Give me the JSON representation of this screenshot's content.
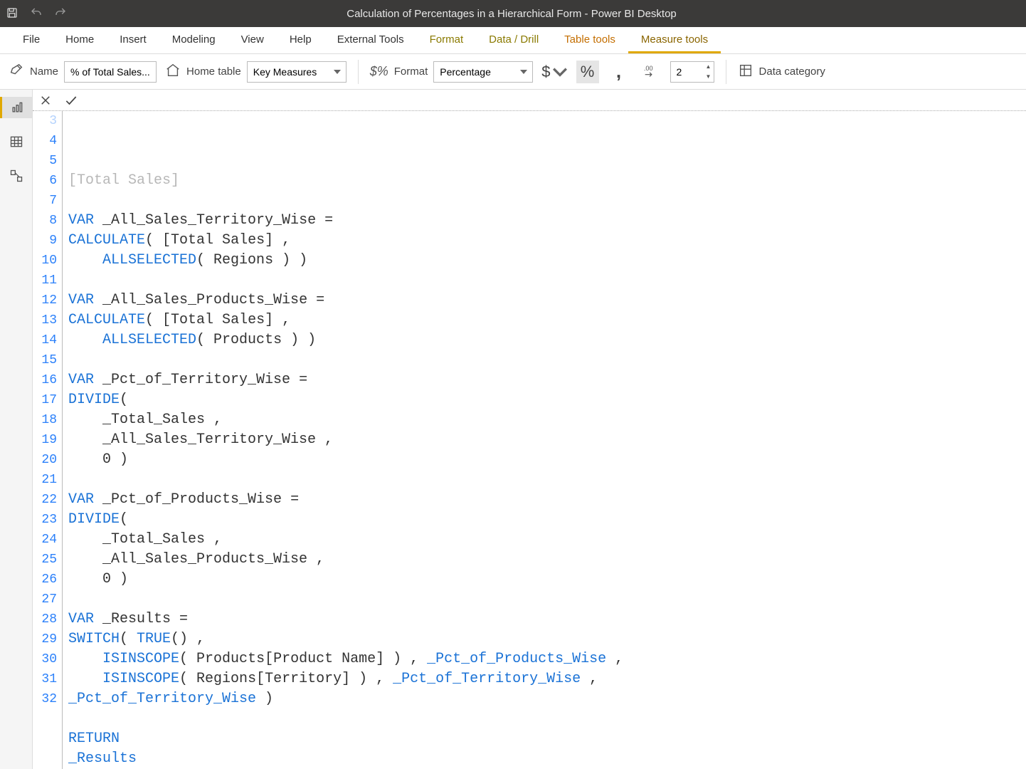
{
  "titlebar": {
    "title": "Calculation of Percentages in a Hierarchical Form - Power BI Desktop"
  },
  "ribbon_tabs": {
    "file": "File",
    "home": "Home",
    "insert": "Insert",
    "modeling": "Modeling",
    "view": "View",
    "help": "Help",
    "external_tools": "External Tools",
    "format": "Format",
    "data_drill": "Data / Drill",
    "table_tools": "Table tools",
    "measure_tools": "Measure tools"
  },
  "ribbon": {
    "name_label": "Name",
    "name_value": "% of Total Sales...",
    "home_table_label": "Home table",
    "home_table_value": "Key Measures",
    "format_label": "Format",
    "format_value": "Percentage",
    "decimals_value": "2",
    "data_category_label": "Data category"
  },
  "code_lines": [
    {
      "n": 3,
      "tokens": [
        {
          "t": "[Total Sales]",
          "c": "txt"
        }
      ],
      "faded": true
    },
    {
      "n": 4,
      "tokens": []
    },
    {
      "n": 5,
      "tokens": [
        {
          "t": "VAR",
          "c": "kw"
        },
        {
          "t": " _All_Sales_Territory_Wise ",
          "c": "txt"
        },
        {
          "t": "=",
          "c": "op"
        }
      ]
    },
    {
      "n": 6,
      "tokens": [
        {
          "t": "CALCULATE",
          "c": "fn"
        },
        {
          "t": "( ",
          "c": "op"
        },
        {
          "t": "[Total Sales]",
          "c": "txt"
        },
        {
          "t": " ,",
          "c": "op"
        }
      ]
    },
    {
      "n": 7,
      "tokens": [
        {
          "t": "    ",
          "c": "txt"
        },
        {
          "t": "ALLSELECTED",
          "c": "fn"
        },
        {
          "t": "( Regions ) )",
          "c": "txt"
        }
      ]
    },
    {
      "n": 8,
      "tokens": []
    },
    {
      "n": 9,
      "tokens": [
        {
          "t": "VAR",
          "c": "kw"
        },
        {
          "t": " _All_Sales_Products_Wise ",
          "c": "txt"
        },
        {
          "t": "=",
          "c": "op"
        }
      ]
    },
    {
      "n": 10,
      "tokens": [
        {
          "t": "CALCULATE",
          "c": "fn"
        },
        {
          "t": "( ",
          "c": "op"
        },
        {
          "t": "[Total Sales]",
          "c": "txt"
        },
        {
          "t": " ,",
          "c": "op"
        }
      ]
    },
    {
      "n": 11,
      "tokens": [
        {
          "t": "    ",
          "c": "txt"
        },
        {
          "t": "ALLSELECTED",
          "c": "fn"
        },
        {
          "t": "( Products ) )",
          "c": "txt"
        }
      ]
    },
    {
      "n": 12,
      "tokens": []
    },
    {
      "n": 13,
      "tokens": [
        {
          "t": "VAR",
          "c": "kw"
        },
        {
          "t": " _Pct_of_Territory_Wise ",
          "c": "txt"
        },
        {
          "t": "=",
          "c": "op"
        }
      ]
    },
    {
      "n": 14,
      "tokens": [
        {
          "t": "DIVIDE",
          "c": "fn"
        },
        {
          "t": "(",
          "c": "op"
        }
      ]
    },
    {
      "n": 15,
      "tokens": [
        {
          "t": "    _Total_Sales ,",
          "c": "txt"
        }
      ]
    },
    {
      "n": 16,
      "tokens": [
        {
          "t": "    _All_Sales_Territory_Wise ,",
          "c": "txt"
        }
      ]
    },
    {
      "n": 17,
      "tokens": [
        {
          "t": "    0 )",
          "c": "txt"
        }
      ]
    },
    {
      "n": 18,
      "tokens": []
    },
    {
      "n": 19,
      "tokens": [
        {
          "t": "VAR",
          "c": "kw"
        },
        {
          "t": " _Pct_of_Products_Wise ",
          "c": "txt"
        },
        {
          "t": "=",
          "c": "op"
        }
      ]
    },
    {
      "n": 20,
      "tokens": [
        {
          "t": "DIVIDE",
          "c": "fn"
        },
        {
          "t": "(",
          "c": "op"
        }
      ]
    },
    {
      "n": 21,
      "tokens": [
        {
          "t": "    _Total_Sales ,",
          "c": "txt"
        }
      ]
    },
    {
      "n": 22,
      "tokens": [
        {
          "t": "    _All_Sales_Products_Wise ,",
          "c": "txt"
        }
      ]
    },
    {
      "n": 23,
      "tokens": [
        {
          "t": "    0 )",
          "c": "txt"
        }
      ]
    },
    {
      "n": 24,
      "tokens": []
    },
    {
      "n": 25,
      "tokens": [
        {
          "t": "VAR",
          "c": "kw"
        },
        {
          "t": " _Results ",
          "c": "txt"
        },
        {
          "t": "=",
          "c": "op"
        }
      ]
    },
    {
      "n": 26,
      "tokens": [
        {
          "t": "SWITCH",
          "c": "fn"
        },
        {
          "t": "( ",
          "c": "op"
        },
        {
          "t": "TRUE",
          "c": "fn"
        },
        {
          "t": "() ,",
          "c": "op"
        }
      ]
    },
    {
      "n": 27,
      "tokens": [
        {
          "t": "    ",
          "c": "txt"
        },
        {
          "t": "ISINSCOPE",
          "c": "fn"
        },
        {
          "t": "( Products[Product Name] ) , ",
          "c": "txt"
        },
        {
          "t": "_Pct_of_Products_Wise",
          "c": "fn"
        },
        {
          "t": " ,",
          "c": "txt"
        }
      ]
    },
    {
      "n": 28,
      "tokens": [
        {
          "t": "    ",
          "c": "txt"
        },
        {
          "t": "ISINSCOPE",
          "c": "fn"
        },
        {
          "t": "( Regions[Territory] ) , ",
          "c": "txt"
        },
        {
          "t": "_Pct_of_Territory_Wise",
          "c": "fn"
        },
        {
          "t": " ,",
          "c": "txt"
        }
      ]
    },
    {
      "n": 29,
      "tokens": [
        {
          "t": "_Pct_of_Territory_Wise",
          "c": "fn"
        },
        {
          "t": " )",
          "c": "txt"
        }
      ]
    },
    {
      "n": 30,
      "tokens": []
    },
    {
      "n": 31,
      "tokens": [
        {
          "t": "RETURN",
          "c": "kw"
        }
      ]
    },
    {
      "n": 32,
      "tokens": [
        {
          "t": "_Results",
          "c": "fn"
        }
      ]
    }
  ]
}
